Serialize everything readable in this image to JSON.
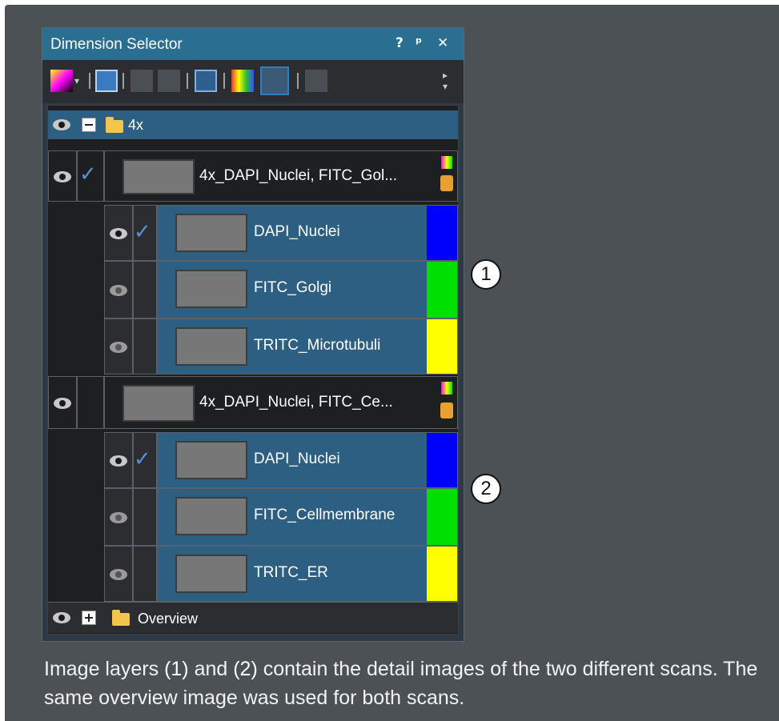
{
  "panel": {
    "title": "Dimension Selector",
    "title_buttons": [
      "?",
      "⎑",
      "✕"
    ]
  },
  "toolbar": {
    "icons": [
      "color-mode-icon",
      "dropdown-arrow-icon",
      "image-layer-icon",
      "add-layer-icon",
      "merge-layer-icon",
      "view-settings-icon",
      "channel-colors-icon",
      "single-channel-icon",
      "delete-icon",
      "overflow-icon"
    ]
  },
  "tree": {
    "folder_4x": "4x",
    "group1": {
      "label": "4x_DAPI_Nuclei, FITC_Gol...",
      "channels": [
        {
          "name": "DAPI_Nuclei",
          "color": "#0000ff",
          "checked": true
        },
        {
          "name": "FITC_Golgi",
          "color": "#00e000",
          "checked": false
        },
        {
          "name": "TRITC_Microtubuli",
          "color": "#ffff00",
          "checked": false
        }
      ]
    },
    "group2": {
      "label": "4x_DAPI_Nuclei, FITC_Ce...",
      "channels": [
        {
          "name": "DAPI_Nuclei",
          "color": "#0000ff",
          "checked": true
        },
        {
          "name": "FITC_Cellmembrane",
          "color": "#00e000",
          "checked": false
        },
        {
          "name": "TRITC_ER",
          "color": "#ffff00",
          "checked": false
        }
      ]
    },
    "folder_overview": "Overview"
  },
  "callouts": [
    "1",
    "2"
  ],
  "caption": {
    "part1": "Image layers ",
    "ref1": "(1)",
    "part2": " and ",
    "ref2": "(2)",
    "part3": " contain the detail images of the two different scans. The same overview image was used for both scans."
  },
  "colors": {
    "background": "#4b5155",
    "title_bar": "#2a6e92",
    "selected_row": "#2d5f82",
    "blue": "#0000ff",
    "green": "#00e000",
    "yellow": "#ffff00"
  }
}
